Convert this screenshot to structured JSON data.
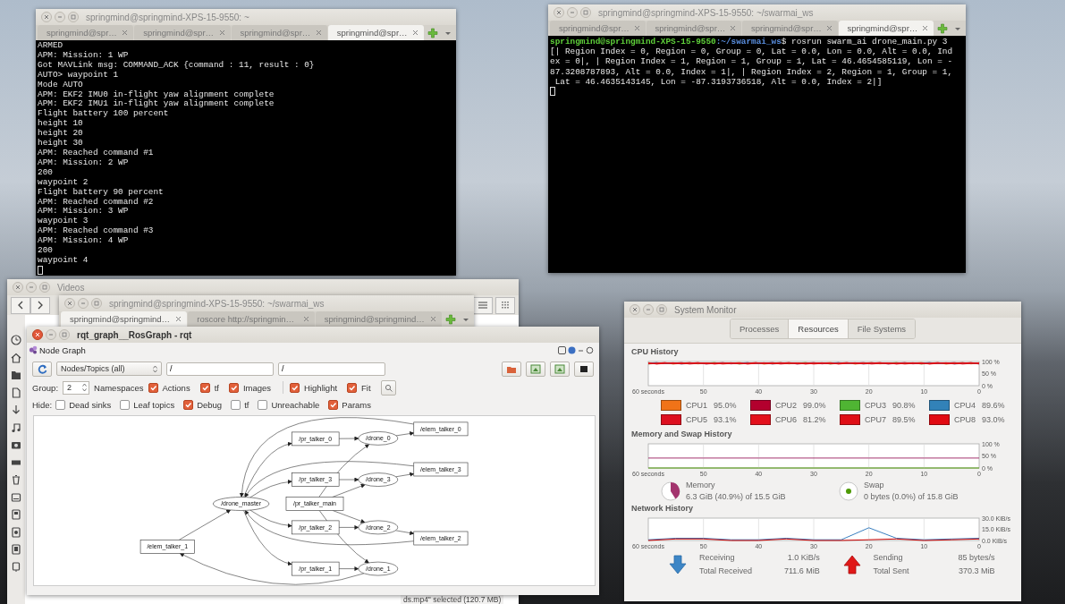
{
  "terminal_home": {
    "title": "springmind@springmind-XPS-15-9550: ~",
    "tabs": [
      {
        "label": "springmind@spr…",
        "selected": false
      },
      {
        "label": "springmind@spr…",
        "selected": false
      },
      {
        "label": "springmind@spr…",
        "selected": false
      },
      {
        "label": "springmind@spr…",
        "selected": true
      }
    ],
    "lines": [
      "ARMED",
      "APM: Mission: 1 WP",
      "Got MAVLink msg: COMMAND_ACK {command : 11, result : 0}",
      "AUTO> waypoint 1",
      "Mode AUTO",
      "APM: EKF2 IMU0 in-flight yaw alignment complete",
      "APM: EKF2 IMU1 in-flight yaw alignment complete",
      "Flight battery 100 percent",
      "height 10",
      "height 20",
      "height 30",
      "APM: Reached command #1",
      "APM: Mission: 2 WP",
      "200",
      "waypoint 2",
      "Flight battery 90 percent",
      "APM: Reached command #2",
      "APM: Mission: 3 WP",
      "waypoint 3",
      "APM: Reached command #3",
      "APM: Mission: 4 WP",
      "200",
      "waypoint 4"
    ]
  },
  "terminal_swarm": {
    "title": "springmind@springmind-XPS-15-9550: ~/swarmai_ws",
    "tabs": [
      {
        "label": "springmind@spr…",
        "selected": false
      },
      {
        "label": "springmind@spr…",
        "selected": false
      },
      {
        "label": "springmind@spr…",
        "selected": false
      },
      {
        "label": "springmind@spr…",
        "selected": true
      }
    ],
    "prompt_user": "springmind@springmind-XPS-15-9550",
    "prompt_path": ":~/swarmai_ws",
    "command": "$ rosrun swarm_ai drone_main.py 3",
    "lines": [
      "[| Region Index = 0, Region = 0, Group = 0, Lat = 0.0, Lon = 0.0, Alt = 0.0, Ind",
      "ex = 0|, | Region Index = 1, Region = 1, Group = 1, Lat = 46.4654585119, Lon = -",
      "87.3208787893, Alt = 0.0, Index = 1|, | Region Index = 2, Region = 1, Group = 1,",
      " Lat = 46.4635143145, Lon = -87.3193736518, Alt = 0.0, Index = 2|]"
    ]
  },
  "videos_window": {
    "title": "Videos",
    "status": "ds.mp4\" selected (120.7 MB)"
  },
  "terminal_roscore": {
    "title": "springmind@springmind-XPS-15-9550: ~/swarmai_ws",
    "tabs": [
      {
        "label": "springmind@springmind…",
        "selected": true
      },
      {
        "label": "roscore http://springmin…",
        "selected": false
      },
      {
        "label": "springmind@springmind…",
        "selected": false
      }
    ]
  },
  "rqt": {
    "title": "rqt_graph__RosGraph - rqt",
    "plugin_title": "Node Graph",
    "filter_mode": "Nodes/Topics (all)",
    "node_filter": "/",
    "topic_filter": "/",
    "group_label": "Group:",
    "group_value": "2",
    "namespaces_label": "Namespaces",
    "show_options": [
      {
        "label": "Actions",
        "checked": true
      },
      {
        "label": "tf",
        "checked": true
      },
      {
        "label": "Images",
        "checked": true
      }
    ],
    "view_options": [
      {
        "label": "Highlight",
        "checked": true
      },
      {
        "label": "Fit",
        "checked": true
      }
    ],
    "hide_label": "Hide:",
    "hide_options": [
      {
        "label": "Dead sinks",
        "checked": false
      },
      {
        "label": "Leaf topics",
        "checked": false
      },
      {
        "label": "Debug",
        "checked": true
      },
      {
        "label": "tf",
        "checked": false
      },
      {
        "label": "Unreachable",
        "checked": false
      },
      {
        "label": "Params",
        "checked": true
      }
    ],
    "nodes": [
      {
        "label": "/elem_talker_0",
        "kind": "topic"
      },
      {
        "label": "/pr_talker_0",
        "kind": "topic"
      },
      {
        "label": "/drone_0",
        "kind": "node"
      },
      {
        "label": "/elem_talker_3",
        "kind": "topic"
      },
      {
        "label": "/pr_talker_3",
        "kind": "topic"
      },
      {
        "label": "/drone_3",
        "kind": "node"
      },
      {
        "label": "/drone_master",
        "kind": "node"
      },
      {
        "label": "/pr_talker_main",
        "kind": "topic"
      },
      {
        "label": "/pr_talker_2",
        "kind": "topic"
      },
      {
        "label": "/drone_2",
        "kind": "node"
      },
      {
        "label": "/elem_talker_2",
        "kind": "topic"
      },
      {
        "label": "/elem_talker_1",
        "kind": "topic"
      },
      {
        "label": "/pr_talker_1",
        "kind": "topic"
      },
      {
        "label": "/drone_1",
        "kind": "node"
      }
    ]
  },
  "system_monitor": {
    "title": "System Monitor",
    "tabs": [
      {
        "label": "Processes",
        "selected": false
      },
      {
        "label": "Resources",
        "selected": true
      },
      {
        "label": "File Systems",
        "selected": false
      }
    ],
    "cpu_history": {
      "heading": "CPU History",
      "x_labels": [
        "60 seconds",
        "50",
        "40",
        "30",
        "20",
        "10",
        "0"
      ],
      "y_labels": [
        "100 %",
        "50 %",
        "0 %"
      ],
      "legend": [
        {
          "label": "CPU1",
          "reading": "95.0%",
          "color": "#f07318"
        },
        {
          "label": "CPU2",
          "reading": "99.0%",
          "color": "#b3002e"
        },
        {
          "label": "CPU3",
          "reading": "90.8%",
          "color": "#4fb533"
        },
        {
          "label": "CPU4",
          "reading": "89.6%",
          "color": "#3282b8"
        },
        {
          "label": "CPU5",
          "reading": "93.1%",
          "color": "#dd1020"
        },
        {
          "label": "CPU6",
          "reading": "81.2%",
          "color": "#e3101c"
        },
        {
          "label": "CPU7",
          "reading": "89.5%",
          "color": "#df0e16"
        },
        {
          "label": "CPU8",
          "reading": "93.0%",
          "color": "#e10a12"
        }
      ]
    },
    "memory_history": {
      "heading": "Memory and Swap History",
      "chart_data": {
        "type": "line",
        "grid": true,
        "x": [
          60,
          50,
          40,
          30,
          20,
          10,
          0
        ],
        "xlim": [
          60,
          0
        ],
        "ylim": [
          0,
          100
        ],
        "xticks": [
          {
            "value": 60,
            "label": "60 seconds"
          },
          50,
          40,
          30,
          20,
          10,
          0
        ],
        "yticks": [
          {
            "value": 100,
            "label": "100 %"
          },
          {
            "value": 50,
            "label": "50 %"
          },
          {
            "value": 0,
            "label": "0 %"
          }
        ],
        "series": [
          {
            "name": "Memory",
            "color": "#a3346e",
            "values": [
              41,
              41,
              41,
              41,
              41,
              41,
              41
            ]
          },
          {
            "name": "Swap",
            "color": "#4e9a06",
            "values": [
              0,
              0,
              0,
              0,
              0,
              0,
              0
            ]
          }
        ]
      },
      "legend": [
        {
          "reading": "6.3 GiB (40.9%) of 15.5 GiB",
          "level": 0.409
        },
        {
          "reading": "0 bytes (0.0%) of 15.8 GiB"
        }
      ]
    },
    "network_history": {
      "heading": "Network History",
      "chart_data": {
        "type": "line",
        "grid": true,
        "x": [
          60,
          55,
          50,
          45,
          40,
          35,
          30,
          25,
          20,
          15,
          10,
          5,
          0
        ],
        "xlim": [
          60,
          0
        ],
        "ylim": [
          0,
          30
        ],
        "xticks": [
          {
            "value": 60,
            "label": "60 seconds"
          },
          50,
          40,
          30,
          20,
          10,
          0
        ],
        "yticks": [
          {
            "value": 30,
            "label": "30.0 KiB/s"
          },
          {
            "value": 15,
            "label": "15.0 KiB/s"
          },
          {
            "value": 0,
            "label": "0.0 KiB/s"
          }
        ],
        "series": [
          {
            "name": "Receiving",
            "color": "#3a7fc0",
            "values": [
              1,
              3,
              3,
              1,
              1,
              3,
              1,
              1,
              17,
              3,
              1,
              2,
              3
            ]
          },
          {
            "name": "Sending",
            "color": "#cc0000",
            "values": [
              0,
              2,
              2,
              0,
              0,
              2,
              0,
              0,
              1,
              2,
              0,
              1,
              2
            ]
          }
        ]
      },
      "legend": [
        {
          "kind": "receive",
          "rate": "1.0 KiB/s",
          "total_label": "Total Received",
          "total": "711.6 MiB"
        },
        {
          "kind": "send",
          "rate": "85 bytes/s",
          "total_label": "Total Sent",
          "total": "370.3 MiB"
        }
      ]
    }
  }
}
